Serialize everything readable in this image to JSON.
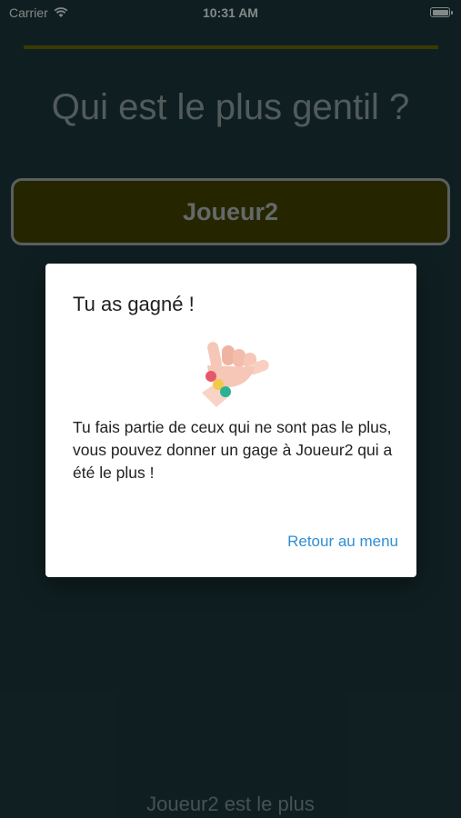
{
  "status_bar": {
    "carrier": "Carrier",
    "time": "10:31 AM"
  },
  "screen": {
    "question": "Qui est le plus gentil ?",
    "player_button_label": "Joueur2",
    "footer_text": "Joueur2 est le plus"
  },
  "dialog": {
    "title": "Tu as gagné !",
    "image_icon": "hand-with-bracelet-icon",
    "body": "Tu fais partie de ceux qui ne sont pas le plus, vous pouvez donner un gage à Joueur2 qui a été le plus !",
    "action_label": "Retour au menu",
    "accent_color": "#2f8fd4"
  }
}
